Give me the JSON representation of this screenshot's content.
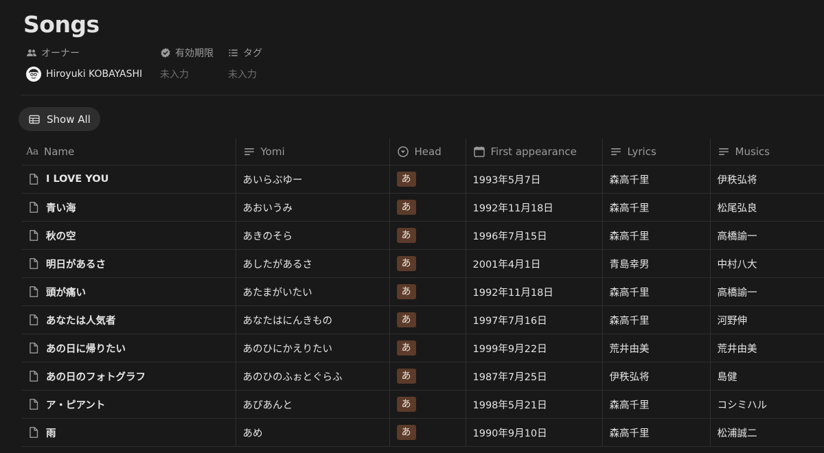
{
  "page": {
    "title": "Songs"
  },
  "properties": {
    "owner": {
      "label": "オーナー",
      "value": "Hiroyuki KOBAYASHI"
    },
    "expiry": {
      "label": "有効期限",
      "value": "未入力"
    },
    "tags": {
      "label": "タグ",
      "value": "未入力"
    }
  },
  "view": {
    "label": "Show All"
  },
  "table": {
    "columns": {
      "name": "Name",
      "yomi": "Yomi",
      "head": "Head",
      "first": "First appearance",
      "lyrics": "Lyrics",
      "musics": "Musics"
    },
    "rows": [
      {
        "name": "I LOVE YOU",
        "yomi": "あいらぶゆー",
        "head": "あ",
        "first": "1993年5月7日",
        "lyrics": "森高千里",
        "musics": "伊秩弘将"
      },
      {
        "name": "青い海",
        "yomi": "あおいうみ",
        "head": "あ",
        "first": "1992年11月18日",
        "lyrics": "森高千里",
        "musics": "松尾弘良"
      },
      {
        "name": "秋の空",
        "yomi": "あきのそら",
        "head": "あ",
        "first": "1996年7月15日",
        "lyrics": "森高千里",
        "musics": "高橋諭一"
      },
      {
        "name": "明日があるさ",
        "yomi": "あしたがあるさ",
        "head": "あ",
        "first": "2001年4月1日",
        "lyrics": "青島幸男",
        "musics": "中村八大"
      },
      {
        "name": "頭が痛い",
        "yomi": "あたまがいたい",
        "head": "あ",
        "first": "1992年11月18日",
        "lyrics": "森高千里",
        "musics": "高橋諭一"
      },
      {
        "name": "あなたは人気者",
        "yomi": "あなたはにんきもの",
        "head": "あ",
        "first": "1997年7月16日",
        "lyrics": "森高千里",
        "musics": "河野伸"
      },
      {
        "name": "あの日に帰りたい",
        "yomi": "あのひにかえりたい",
        "head": "あ",
        "first": "1999年9月22日",
        "lyrics": "荒井由美",
        "musics": "荒井由美"
      },
      {
        "name": "あの日のフォトグラフ",
        "yomi": "あのひのふぉとぐらふ",
        "head": "あ",
        "first": "1987年7月25日",
        "lyrics": "伊秩弘将",
        "musics": "島健"
      },
      {
        "name": "ア・ピアント",
        "yomi": "あぴあんと",
        "head": "あ",
        "first": "1998年5月21日",
        "lyrics": "森高千里",
        "musics": "コシミハル"
      },
      {
        "name": "雨",
        "yomi": "あめ",
        "head": "あ",
        "first": "1990年9月10日",
        "lyrics": "森高千里",
        "musics": "松浦誠二"
      }
    ]
  },
  "colors": {
    "background": "#191919",
    "head_tag_bg": "#5c3b2a",
    "head_tag_text": "#f0e6dc",
    "muted_text": "#9b9b9b"
  }
}
